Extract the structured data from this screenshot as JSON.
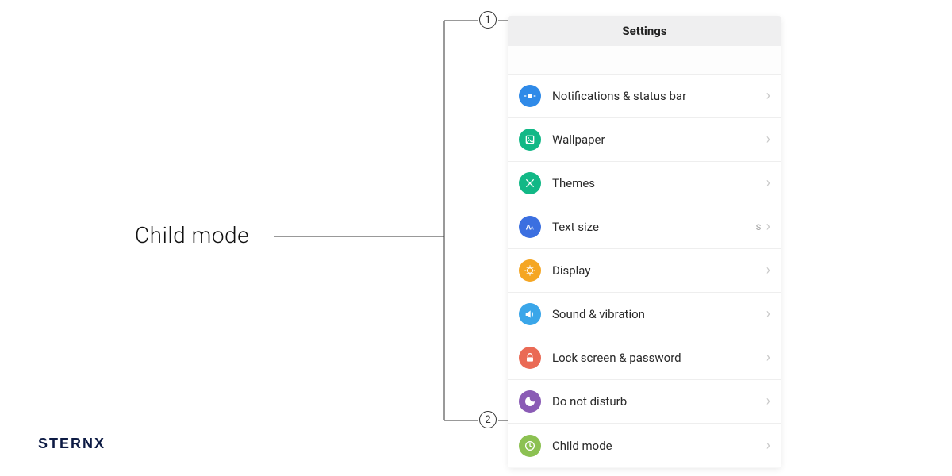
{
  "callout_label": "Child mode",
  "brand": "STERNX",
  "markers": {
    "one": "1",
    "two": "2"
  },
  "phone": {
    "header_title": "Settings",
    "rows": [
      {
        "label": "Notifications & status bar",
        "value": "",
        "icon_bg": "#2f8ae8",
        "icon": "notifications"
      },
      {
        "label": "Wallpaper",
        "value": "",
        "icon_bg": "#12b886",
        "icon": "wallpaper"
      },
      {
        "label": "Themes",
        "value": "",
        "icon_bg": "#12b886",
        "icon": "themes"
      },
      {
        "label": "Text size",
        "value": "s",
        "icon_bg": "#3b6fe0",
        "icon": "textsize"
      },
      {
        "label": "Display",
        "value": "",
        "icon_bg": "#f5a623",
        "icon": "display"
      },
      {
        "label": "Sound & vibration",
        "value": "",
        "icon_bg": "#3aa6e9",
        "icon": "sound"
      },
      {
        "label": "Lock screen & password",
        "value": "",
        "icon_bg": "#ea6a55",
        "icon": "lock"
      },
      {
        "label": "Do not disturb",
        "value": "",
        "icon_bg": "#8a5bb5",
        "icon": "dnd"
      },
      {
        "label": "Child mode",
        "value": "",
        "icon_bg": "#8cc152",
        "icon": "child"
      }
    ]
  }
}
